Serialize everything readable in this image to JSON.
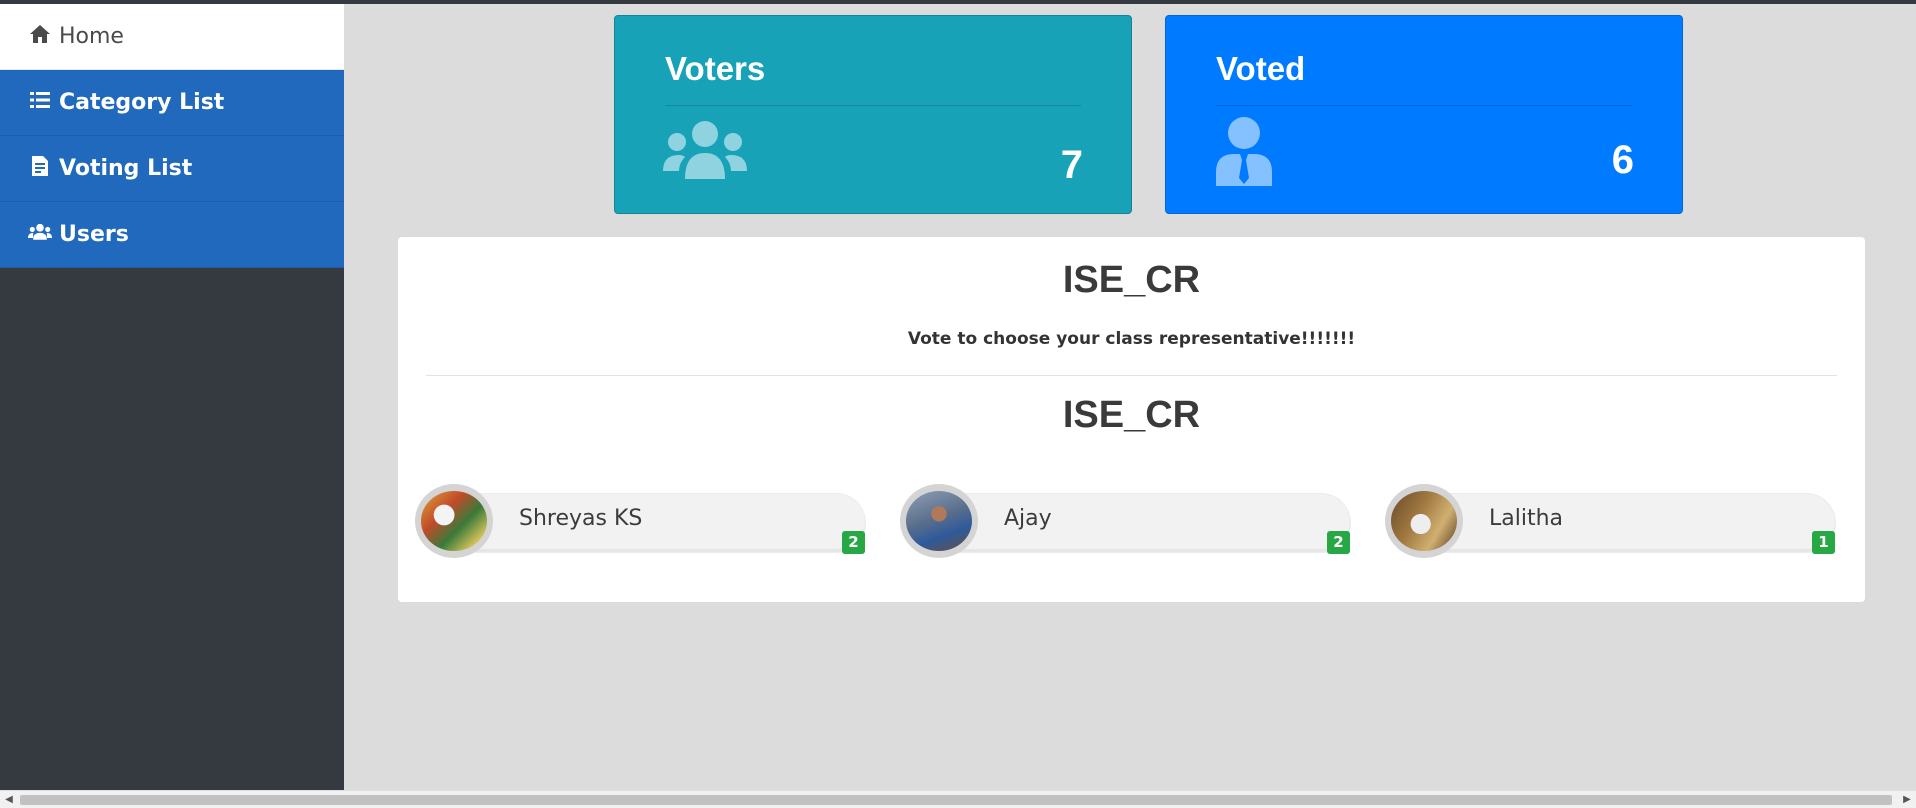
{
  "sidebar": {
    "items": [
      {
        "label": "Home",
        "icon": "home-icon",
        "active": true
      },
      {
        "label": "Category List",
        "icon": "list-icon",
        "active": false
      },
      {
        "label": "Voting List",
        "icon": "file-text-icon",
        "active": false
      },
      {
        "label": "Users",
        "icon": "users-icon",
        "active": false
      }
    ]
  },
  "stats": {
    "voters": {
      "title": "Voters",
      "count": "7",
      "icon": "users-group-icon",
      "color": "#17a2b8"
    },
    "voted": {
      "title": "Voted",
      "count": "6",
      "icon": "user-tie-icon",
      "color": "#007bff"
    }
  },
  "category": {
    "title": "ISE_CR",
    "description": "Vote to choose your class representative!!!!!!!",
    "subtitle": "ISE_CR",
    "candidates": [
      {
        "name": "Shreyas KS",
        "votes": "2"
      },
      {
        "name": "Ajay",
        "votes": "2"
      },
      {
        "name": "Lalitha",
        "votes": "1"
      }
    ]
  },
  "colors": {
    "sidebar_bg": "#343a40",
    "nav_blue": "#2169bd",
    "badge_green": "#28a745"
  }
}
